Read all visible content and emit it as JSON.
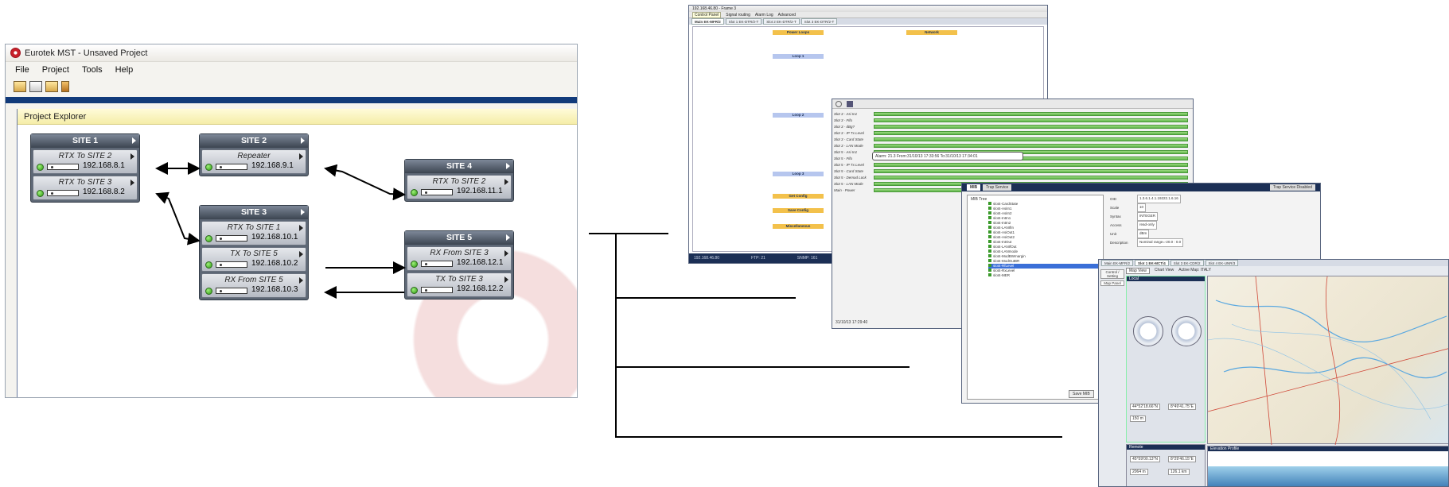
{
  "main_window": {
    "title": "Eurotek MST - Unsaved Project",
    "menu": [
      "File",
      "Project",
      "Tools",
      "Help"
    ],
    "toolbar_icons": [
      "new-project-icon",
      "open-icon",
      "folder-icon",
      "save-icon"
    ],
    "explorer_title": "Project Explorer"
  },
  "sites": [
    {
      "name": "SITE 1",
      "links": [
        {
          "label": "RTX To SITE 2",
          "ip": "192.168.8.1"
        },
        {
          "label": "RTX To SITE 3",
          "ip": "192.168.8.2"
        }
      ]
    },
    {
      "name": "SITE 2",
      "links": [
        {
          "label": "Repeater",
          "ip": "192.168.9.1"
        }
      ]
    },
    {
      "name": "SITE 3",
      "links": [
        {
          "label": "RTX To SITE 1",
          "ip": "192.168.10.1"
        },
        {
          "label": "TX To SITE 5",
          "ip": "192.168.10.2"
        },
        {
          "label": "RX From SITE 5",
          "ip": "192.168.10.3"
        }
      ]
    },
    {
      "name": "SITE 4",
      "links": [
        {
          "label": "RTX To SITE 2",
          "ip": "192.168.11.1"
        }
      ]
    },
    {
      "name": "SITE 5",
      "links": [
        {
          "label": "RX From SITE 3",
          "ip": "192.168.12.1"
        },
        {
          "label": "TX To SITE 3",
          "ip": "192.168.12.2"
        }
      ]
    }
  ],
  "panel_window": {
    "title": "192.168.46.80 - Frame 3",
    "toolbar": [
      "Control Panel",
      "Signal routing",
      "Alarm Log",
      "Advanced"
    ],
    "tabs": [
      "Main EK-MFR/2",
      "Slot 1 EK-DTR/2-T",
      "Slot 2 EK-DTR/2-T",
      "Slot 3 EK-DTR/2-T"
    ],
    "sections": [
      "Power Loops",
      "Loop 1",
      "Loop 2",
      "Loop 3",
      "Get Config",
      "Save Config",
      "Miscellaneous",
      "Network"
    ],
    "status": [
      "192.168.46.80",
      "FTP: 21",
      "SNMP: 161"
    ]
  },
  "alarm_window": {
    "rows": [
      "Slot 3 - Asi In1",
      "Slot 3 - Fifo",
      "Slot 3 - dBg?",
      "Slot 3 - IP Tx Level",
      "Slot 3 - Card State",
      "Slot 3 - LAN Mode",
      "Slot 5 - Asi In1",
      "Slot 5 - Fifo",
      "Slot 5 - IP Tx Level",
      "Slot 5 - Card State",
      "Slot 5 - Demod Lock",
      "Slot 5 - LAN Mode",
      "Main - Power"
    ],
    "tooltip": "Alarm: 21.3  From:31/10/13 17:33:56  To:31/10/13 17:34:01",
    "footer": "31/10/13 17:29:40"
  },
  "mib_window": {
    "tabs": [
      "MIB",
      "Trap Service"
    ],
    "trap_status": "Trap Service Disabled",
    "tree_root": "MIB Tree",
    "tree_items": [
      "slot4-CardState",
      "slot4-AsiIn1",
      "slot4-AsiIn2",
      "slot4-IntIn1",
      "slot4-IntIn2",
      "slot4-LANIfIn",
      "slot4-AsiOut1",
      "slot4-AsiOut2",
      "slot4-IntOut",
      "slot4-LANIfOut",
      "slot4-LANmode",
      "slot4-ModBWmargin",
      "slot4-ModOutBR",
      "slot4-RfLevel",
      "slot4-RxLevel",
      "slot4-MER"
    ],
    "fields": [
      {
        "label": "OID",
        "value": "1.3.6.1.4.1.19222.1.6.16"
      },
      {
        "label": "Scale",
        "value": "10"
      },
      {
        "label": "Syntax",
        "value": "INTEGER"
      },
      {
        "label": "Access",
        "value": "read-only"
      },
      {
        "label": "Unit",
        "value": "dBm"
      },
      {
        "label": "Description",
        "value": "Nominal range=-20.0 : 0.0"
      }
    ],
    "save_button": "Save MIB"
  },
  "map_window": {
    "tabs": [
      "Main EK-MFR/2",
      "Slot 1 EK-MCT/4",
      "Slot 3 EK-CDR/2",
      "Slot 4 EK-UNR/3"
    ],
    "side_buttons": [
      "Control / Setting",
      "Map Panel"
    ],
    "view_tabs": [
      "Map View",
      "Chart View",
      "Active Map: ITALY"
    ],
    "local_label": "Local",
    "remote_label": "Remote",
    "elevation_label": "Elevation Profile",
    "gps": {
      "lat": "44°52'18.66\"N",
      "lon": "8°49'41.75\"E",
      "alt": "150 m"
    },
    "remote_gps": {
      "lat": "45°59'00.13\"N",
      "lon": "8°29'46.15\"E",
      "alt": "2064 m",
      "distance": "126.1 km"
    }
  }
}
